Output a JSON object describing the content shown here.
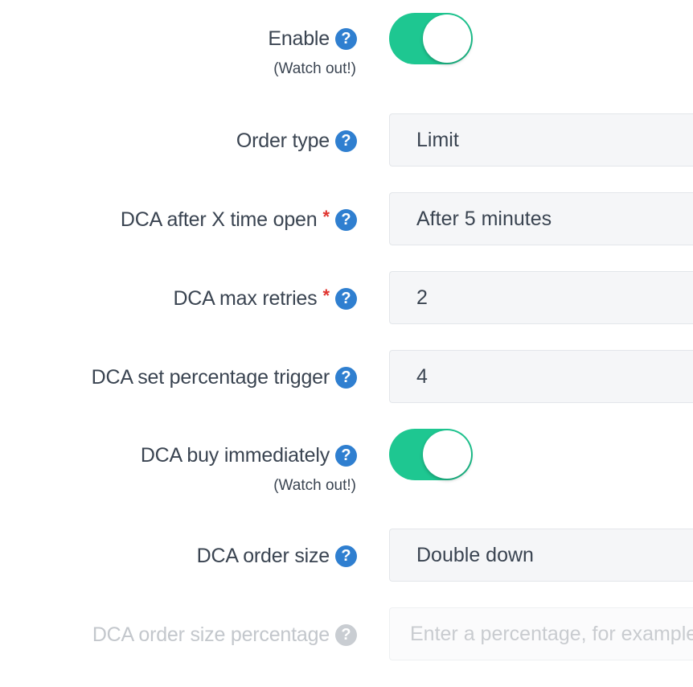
{
  "fields": [
    {
      "id": "enable",
      "label": "Enable",
      "hint": "(Watch out!)",
      "type": "toggle",
      "checked": true
    },
    {
      "id": "order_type",
      "label": "Order type",
      "type": "select",
      "value": "Limit"
    },
    {
      "id": "dca_after_time",
      "label": "DCA after X time open",
      "required_mark": "*",
      "type": "select",
      "value": "After 5 minutes"
    },
    {
      "id": "dca_max_retries",
      "label": "DCA max retries",
      "required_mark": "*",
      "type": "input",
      "value": "2"
    },
    {
      "id": "dca_percentage_trigger",
      "label": "DCA set percentage trigger",
      "type": "input",
      "value": "4"
    },
    {
      "id": "dca_buy_immediately",
      "label": "DCA buy immediately",
      "hint": "(Watch out!)",
      "type": "toggle",
      "checked": true
    },
    {
      "id": "dca_order_size",
      "label": "DCA order size",
      "type": "select",
      "value": "Double down"
    },
    {
      "id": "dca_order_size_percentage",
      "label": "DCA order size percentage",
      "type": "input",
      "disabled": true,
      "placeholder": "Enter a percentage, for example"
    }
  ],
  "icons": {
    "help": "question-circle-icon"
  },
  "colors": {
    "toggle_on": "#1ec791",
    "help_icon": "#2f7fd0",
    "required": "#e0342f",
    "label": "#3a4451",
    "field_bg": "#f5f6f8"
  }
}
